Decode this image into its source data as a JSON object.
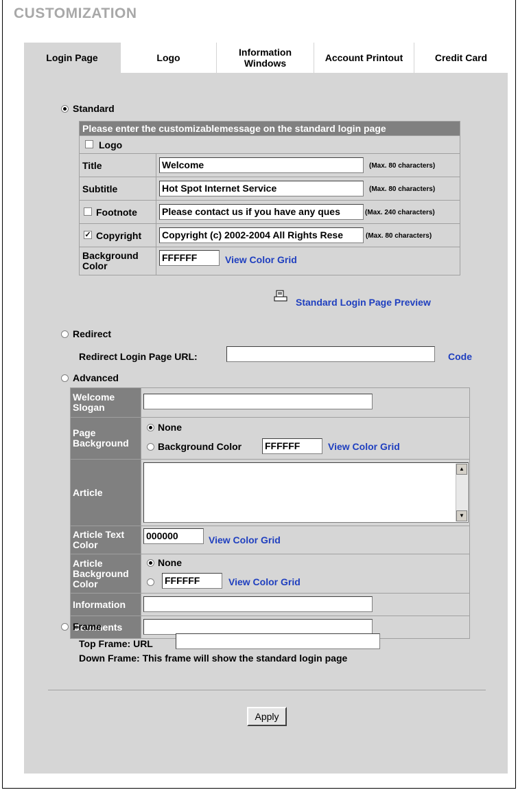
{
  "page_title": "CUSTOMIZATION",
  "tabs": [
    {
      "label": "Login Page",
      "active": true
    },
    {
      "label": "Logo"
    },
    {
      "label": "Information Windows"
    },
    {
      "label": "Account Printout"
    },
    {
      "label": "Credit Card"
    }
  ],
  "standard": {
    "radio_label": "Standard",
    "selected": true,
    "header": "Please enter the customizablemessage on the standard login page",
    "logo_label": "Logo",
    "logo_checked": false,
    "title_label": "Title",
    "title_value": "Welcome",
    "title_note": "(Max. 80 characters)",
    "subtitle_label": "Subtitle",
    "subtitle_value": "Hot Spot Internet Service",
    "subtitle_note": "(Max. 80 characters)",
    "footnote_label": "Footnote",
    "footnote_checked": false,
    "footnote_value": "Please contact us if you have any ques",
    "footnote_note": "(Max. 240 characters)",
    "copyright_label": "Copyright",
    "copyright_checked": true,
    "copyright_value": "Copyright (c) 2002-2004 All Rights Rese",
    "copyright_note": "(Max. 80 characters)",
    "bg_label_1": "Background",
    "bg_label_2": "Color",
    "bg_value": "FFFFFF",
    "view_grid": "View Color Grid",
    "preview_link": "Standard Login Page Preview"
  },
  "redirect": {
    "radio_label": "Redirect",
    "url_label": "Redirect Login Page URL:",
    "url_value": "",
    "code_link": "Code"
  },
  "advanced": {
    "radio_label": "Advanced",
    "welcome_label_1": "Welcome",
    "welcome_label_2": "Slogan",
    "welcome_value": "",
    "page_bg_label_1": "Page",
    "page_bg_label_2": "Background",
    "none_label": "None",
    "bg_color_label": "Background Color",
    "page_bg_value": "FFFFFF",
    "view_grid": "View Color Grid",
    "article_label": "Article",
    "article_value": "",
    "article_text_label_1": "Article Text",
    "article_text_label_2": "Color",
    "article_text_value": "000000",
    "article_bg_label_1": "Article",
    "article_bg_label_2": "Background",
    "article_bg_label_3": "Color",
    "article_bg_value": "FFFFFF",
    "information_label": "Information",
    "information_value": "",
    "comments_label": "Comments",
    "comments_value": ""
  },
  "frame": {
    "radio_label": "Frame",
    "top_label": "Top Frame:  URL",
    "top_value": "",
    "down_text": "Down Frame: This frame will show the standard login page"
  },
  "apply_label": "Apply",
  "colors": {
    "accent_link": "#1f3fbf",
    "panel": "#d6d6d6",
    "label_bg": "#808080"
  }
}
